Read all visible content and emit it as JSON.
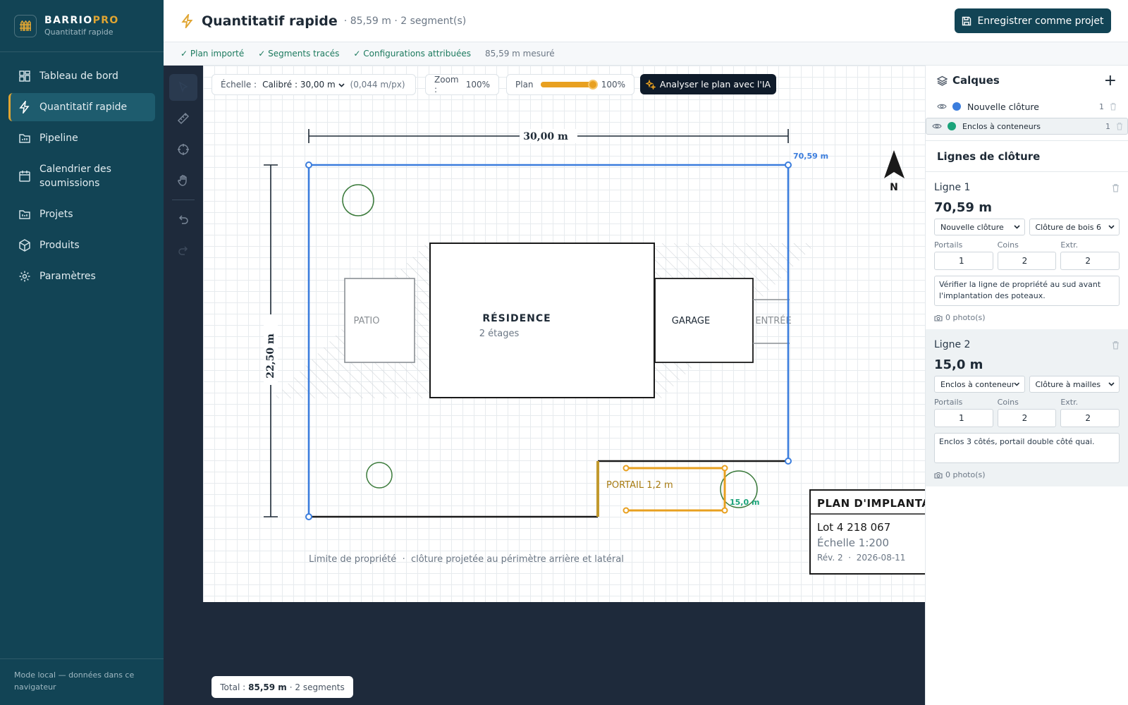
{
  "brand": {
    "name_a": "BARRIO",
    "name_b": "PRO",
    "subtitle": "Quantitatif rapide"
  },
  "sidebar": {
    "items": [
      {
        "label": "Tableau de bord",
        "icon": "dashboard-icon"
      },
      {
        "label": "Quantitatif rapide",
        "icon": "bolt-icon",
        "active": true
      },
      {
        "label": "Pipeline",
        "icon": "folder-icon"
      },
      {
        "label": "Calendrier des soumissions",
        "icon": "calendar-icon"
      },
      {
        "label": "Projets",
        "icon": "projects-icon"
      },
      {
        "label": "Produits",
        "icon": "box-icon"
      },
      {
        "label": "Paramètres",
        "icon": "gear-icon"
      }
    ],
    "footer": "Mode local — données dans ce navigateur"
  },
  "header": {
    "title": "Quantitatif rapide",
    "subtitle": "· 85,59 m · 2 segment(s)",
    "save_label": "Enregistrer comme projet"
  },
  "steps": {
    "s1": "✓ Plan importé",
    "s2": "✓ Segments tracés",
    "s3": "✓ Configurations attribuées",
    "measured": "85,59 m mesuré"
  },
  "canvas_toolbar": {
    "scale_label": "Échelle :",
    "scale_value": "Calibré : 30,00 m",
    "scale_ratio": "(0,044 m/px)",
    "zoom_label": "Zoom :",
    "zoom_value": "100%",
    "plan_label": "Plan",
    "plan_opacity_value": "100%",
    "plan_opacity": 1.0,
    "ai_label": "Analyser le plan avec l'IA"
  },
  "plan": {
    "dim_top": "30,00 m",
    "dim_left": "22,50 m",
    "label_line1": "70,59 m",
    "label_line2": "15,0 m",
    "residence": "RÉSIDENCE",
    "floors": "2 étages",
    "patio": "PATIO",
    "garage": "GARAGE",
    "entry": "ENTRÉE",
    "gate": "PORTAIL 1,2 m",
    "north": "N",
    "caption": "Limite de propriété  ·  clôture projetée au périmètre arrière et latéral",
    "tb_title": "PLAN D'IMPLANTA",
    "tb_lot": "Lot 4 218 067",
    "tb_scale": "Échelle 1:200",
    "tb_rev": "Rév. 2  ·  2026-08-11"
  },
  "total": {
    "label": "Total :",
    "value": "85,59 m",
    "segments": "· 2 segments"
  },
  "layers": {
    "title": "Calques",
    "items": [
      {
        "name": "Nouvelle clôture",
        "color": "#3b7ddd",
        "count": "1"
      },
      {
        "name": "Enclos à conteneurs",
        "color": "#1aa37a",
        "count": "1"
      }
    ]
  },
  "fence_lines": {
    "title": "Lignes de clôture",
    "col_gates": "Portails",
    "col_corners": "Coins",
    "col_ends": "Extr.",
    "lines": [
      {
        "name": "Ligne 1",
        "length": "70,59 m",
        "layer": "Nouvelle clôture",
        "product": "Clôture de bois 6",
        "gates": "1",
        "corners": "2",
        "ends": "2",
        "note": "Vérifier la ligne de propriété au sud avant l'implantation des poteaux.",
        "photos": "0 photo(s)"
      },
      {
        "name": "Ligne 2",
        "length": "15,0 m",
        "layer": "Enclos à conteneurs",
        "product": "Clôture à mailles",
        "gates": "1",
        "corners": "2",
        "ends": "2",
        "note": "Enclos 3 côtés, portail double côté quai.",
        "photos": "0 photo(s)"
      }
    ]
  },
  "colors": {
    "accent": "#e0a532",
    "sidebar": "#124455",
    "line1": "#3b7ddd",
    "line2": "#e8a020",
    "layer2": "#1aa37a"
  }
}
